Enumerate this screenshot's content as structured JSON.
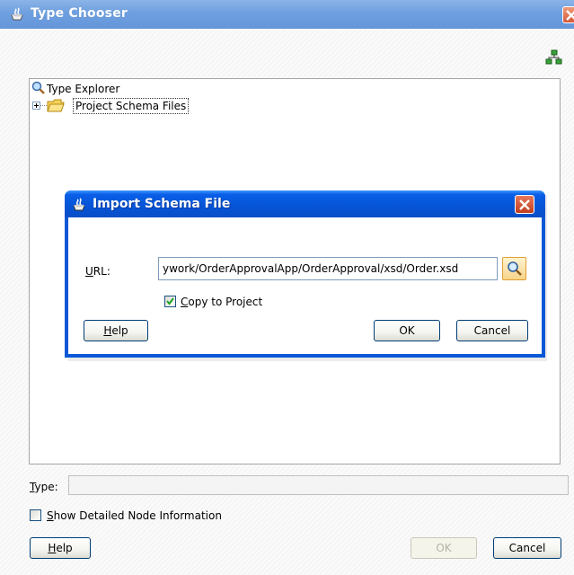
{
  "outer_window": {
    "title": "Type Chooser",
    "tree": {
      "root_label": "Type Explorer",
      "nodes": [
        {
          "label": "Project Schema Files"
        }
      ]
    },
    "type_label": "Type:",
    "type_value": "",
    "show_detailed_label": "Show Detailed Node Information",
    "show_detailed_checked": false,
    "buttons": {
      "help": "Help",
      "ok": "OK",
      "cancel": "Cancel"
    }
  },
  "import_dialog": {
    "title": "Import Schema File",
    "url_label": "URL:",
    "url_value": "ywork/OrderApprovalApp/OrderApproval/xsd/Order.xsd",
    "copy_to_project_label": "Copy to Project",
    "copy_to_project_checked": true,
    "buttons": {
      "help": "Help",
      "ok": "OK",
      "cancel": "Cancel"
    }
  },
  "colors": {
    "outer_titlebar": "#6e9fdf",
    "dialog_titlebar": "#0553d6",
    "close_button": "#d4593a"
  }
}
